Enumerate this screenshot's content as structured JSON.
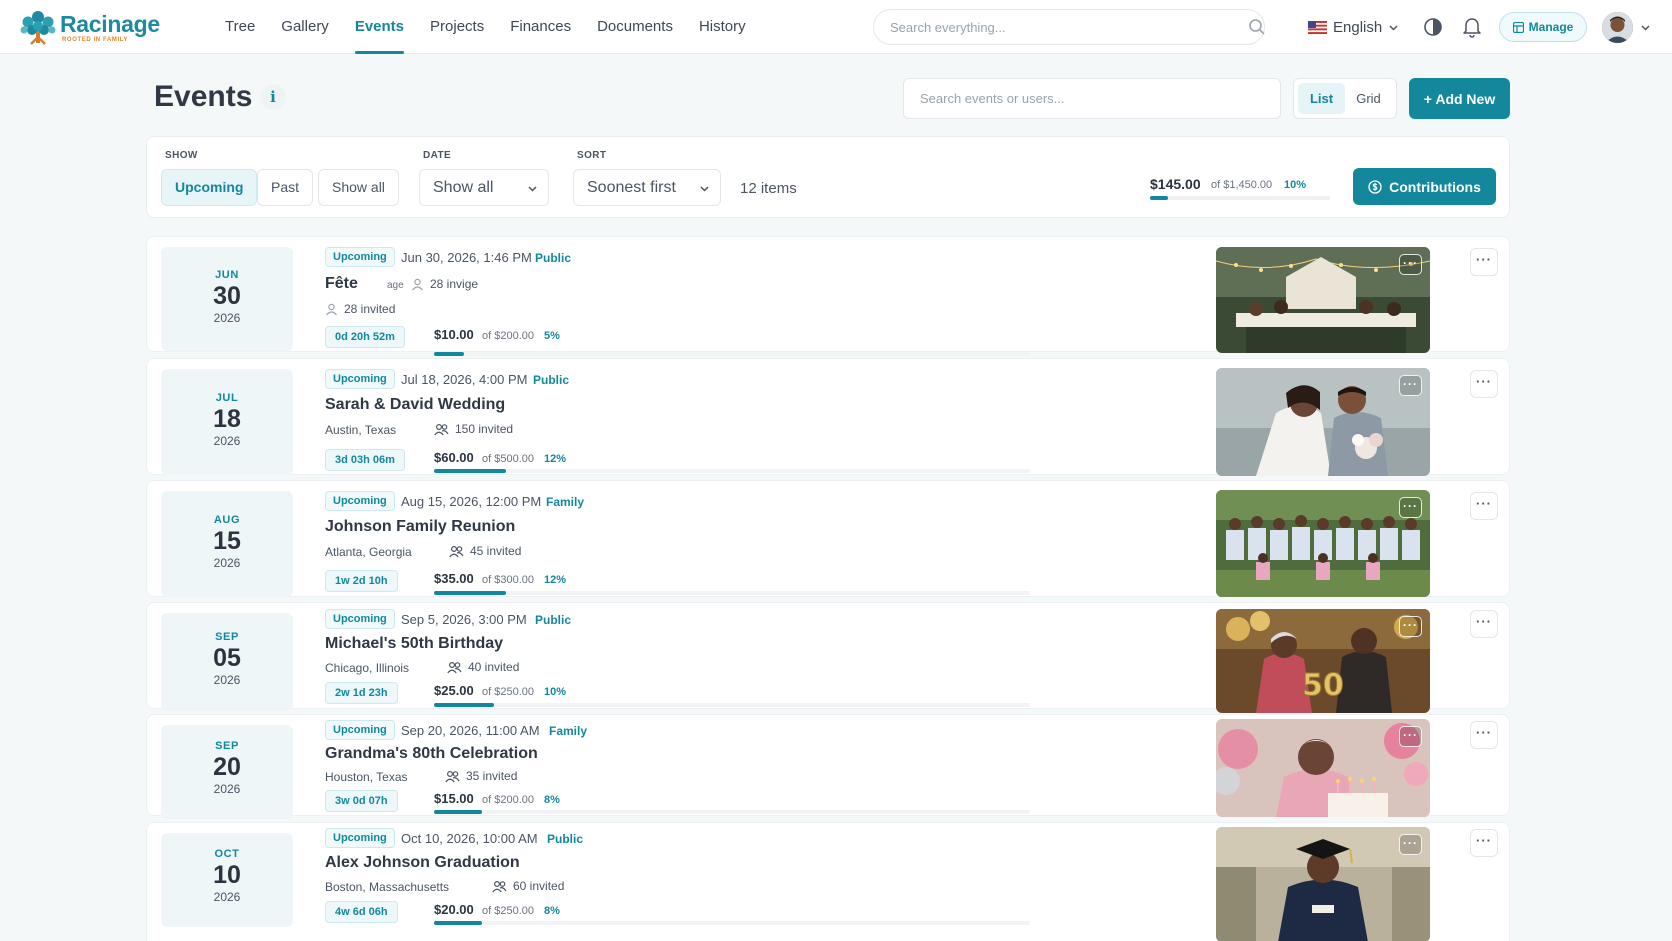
{
  "brand": {
    "name": "Racinage",
    "tagline": "ROOTED IN FAMILY",
    "accent": "#13889c"
  },
  "nav": [
    {
      "label": "Tree"
    },
    {
      "label": "Gallery"
    },
    {
      "label": "Events",
      "active": true
    },
    {
      "label": "Projects"
    },
    {
      "label": "Finances"
    },
    {
      "label": "Documents"
    },
    {
      "label": "History"
    }
  ],
  "header": {
    "search_placeholder": "Search everything...",
    "language": "English",
    "manage_label": "Manage",
    "icons": [
      "search-icon",
      "flag-us-icon",
      "theme-toggle-icon",
      "bell-icon",
      "grid-icon",
      "avatar"
    ]
  },
  "page": {
    "title": "Events",
    "info_label": "i",
    "search_placeholder": "Search events or users...",
    "view_list": "List",
    "view_grid": "Grid",
    "add_label": "+ Add New"
  },
  "filters": {
    "show_label": "SHOW",
    "show_options": [
      "Upcoming",
      "Past",
      "Show all"
    ],
    "date_label": "DATE",
    "date_value": "Show all",
    "sort_label": "SORT",
    "sort_value": "Soonest first",
    "count": "12 items",
    "total_raised": "$145.00",
    "total_of": "of $1,450.00",
    "total_pct": "10%",
    "total_fraction": 0.1,
    "contributions_label": "Contributions"
  },
  "events": [
    {
      "month": "JUN",
      "day": "30",
      "year": "2026",
      "status": "Upcoming",
      "when": "Jun 30, 2026, 1:46 PM",
      "visibility": "Public",
      "title": "Fête",
      "title_overlap": "age",
      "inline_invited": "28 invige",
      "location": "",
      "invited": "28 invited",
      "countdown": "0d 20h 52m",
      "raised": "$10.00",
      "goal": "of $200.00",
      "pct": "5%",
      "fraction": 0.05,
      "photo": "outdoor-party-photo"
    },
    {
      "month": "JUL",
      "day": "18",
      "year": "2026",
      "status": "Upcoming",
      "when": "Jul 18, 2026, 4:00 PM",
      "visibility": "Public",
      "title": "Sarah & David Wedding",
      "location": "Austin, Texas",
      "invited": "150 invited",
      "countdown": "3d 03h 06m",
      "raised": "$60.00",
      "goal": "of $500.00",
      "pct": "12%",
      "fraction": 0.12,
      "photo": "wedding-couple-photo"
    },
    {
      "month": "AUG",
      "day": "15",
      "year": "2026",
      "status": "Upcoming",
      "when": "Aug 15, 2026, 12:00 PM",
      "visibility": "Family",
      "title": "Johnson Family Reunion",
      "location": "Atlanta, Georgia",
      "invited": "45 invited",
      "countdown": "1w 2d 10h",
      "raised": "$35.00",
      "goal": "of $300.00",
      "pct": "12%",
      "fraction": 0.12,
      "photo": "family-group-photo"
    },
    {
      "month": "SEP",
      "day": "05",
      "year": "2026",
      "status": "Upcoming",
      "when": "Sep 5, 2026, 3:00 PM",
      "visibility": "Public",
      "title": "Michael's 50th Birthday",
      "location": "Chicago, Illinois",
      "invited": "40 invited",
      "countdown": "2w 1d 23h",
      "raised": "$25.00",
      "goal": "of $250.00",
      "pct": "10%",
      "fraction": 0.1,
      "photo": "birthday-50-photo",
      "photo_text": "50"
    },
    {
      "month": "SEP",
      "day": "20",
      "year": "2026",
      "status": "Upcoming",
      "when": "Sep 20, 2026, 11:00 AM",
      "visibility": "Family",
      "title": "Grandma's 80th Celebration",
      "location": "Houston, Texas",
      "invited": "35 invited",
      "countdown": "3w 0d 07h",
      "raised": "$15.00",
      "goal": "of $200.00",
      "pct": "8%",
      "fraction": 0.08,
      "photo": "grandma-balloons-photo"
    },
    {
      "month": "OCT",
      "day": "10",
      "year": "2026",
      "status": "Upcoming",
      "when": "Oct 10, 2026, 10:00 AM",
      "visibility": "Public",
      "title": "Alex Johnson Graduation",
      "location": "Boston, Massachusetts",
      "invited": "60 invited",
      "countdown": "4w 6d 06h",
      "raised": "$20.00",
      "goal": "of $250.00",
      "pct": "8%",
      "fraction": 0.08,
      "photo": "graduate-photo"
    }
  ]
}
